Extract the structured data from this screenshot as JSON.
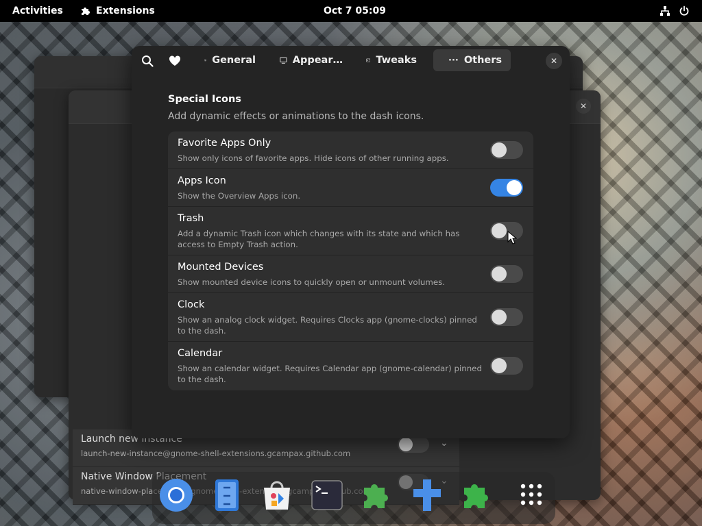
{
  "topbar": {
    "activities": "Activities",
    "app_menu": "Extensions",
    "clock": "Oct 7  05:09"
  },
  "background_window": {
    "rows": [
      {
        "name": "Launch new instance",
        "id": "launch-new-instance@gnome-shell-extensions.gcampax.github.com"
      },
      {
        "name": "Native Window Placement",
        "id": "native-window-placement@gnome-shell-extensions.gcampax.github.com"
      }
    ]
  },
  "tabs": [
    {
      "label": "General",
      "icon": "sliders-icon"
    },
    {
      "label": "Appear…",
      "icon": "monitor-icon"
    },
    {
      "label": "Tweaks",
      "icon": "tweaks-icon"
    },
    {
      "label": "Others",
      "icon": "more-icon"
    }
  ],
  "active_tab": "Others",
  "section": {
    "title": "Special Icons",
    "subtitle": "Add dynamic effects or animations to the dash icons."
  },
  "settings": [
    {
      "title": "Favorite Apps Only",
      "subtitle": "Show only icons of favorite apps. Hide icons of other running apps.",
      "enabled": false
    },
    {
      "title": "Apps Icon",
      "subtitle": "Show the Overview Apps icon.",
      "enabled": true
    },
    {
      "title": "Trash",
      "subtitle": "Add a dynamic Trash icon which changes with its state and which has access to Empty Trash action.",
      "enabled": false
    },
    {
      "title": "Mounted Devices",
      "subtitle": "Show mounted device icons to quickly open or unmount volumes.",
      "enabled": false
    },
    {
      "title": "Clock",
      "subtitle": "Show an analog clock widget. Requires Clocks app (gnome-clocks) pinned to the dash.",
      "enabled": false
    },
    {
      "title": "Calendar",
      "subtitle": "Show an calendar widget. Requires Calendar app (gnome-calendar) pinned to the dash.",
      "enabled": false
    }
  ],
  "colors": {
    "accent": "#3584e4",
    "dialog_bg": "#242424",
    "row_bg": "#2f2f2f",
    "topbar_bg": "#000000"
  },
  "dock": {
    "apps": [
      "chromium-icon",
      "files-icon",
      "software-store-icon",
      "terminal-icon",
      "extensions-icon",
      "extension-manager-icon",
      "extensions-green-icon",
      "app-grid-icon"
    ]
  }
}
